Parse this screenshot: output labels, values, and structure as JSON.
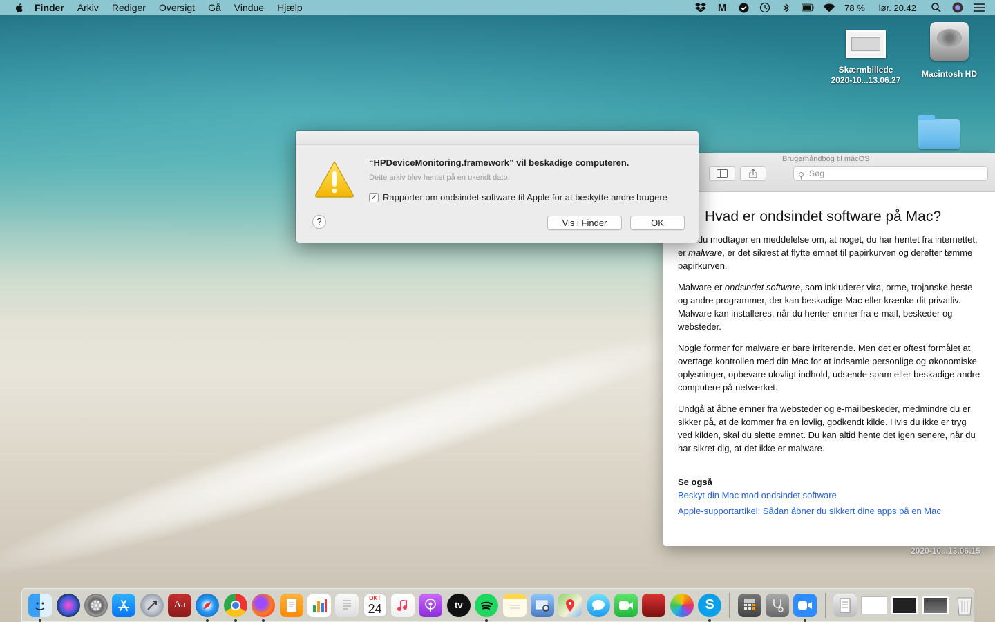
{
  "menubar": {
    "items": [
      "Finder",
      "Arkiv",
      "Rediger",
      "Oversigt",
      "Gå",
      "Vindue",
      "Hjælp"
    ],
    "battery": "78 %",
    "clock": "lør. 20.42",
    "status_icons": [
      "dropbox-icon",
      "m-icon",
      "check-icon",
      "time-machine-icon",
      "bluetooth-icon",
      "battery-icon",
      "wifi-icon",
      "search-icon",
      "siri-icon",
      "list-icon"
    ]
  },
  "desktop": {
    "screenshot_icon_label_1": "Skærmbillede",
    "screenshot_icon_label_2": "2020-10...13.06.27",
    "hd_label": "Macintosh HD",
    "corner_label": "2020-10...13.06.15"
  },
  "alert": {
    "title": "“HPDeviceMonitoring.framework” vil beskadige computeren.",
    "subtitle": "Dette arkiv blev hentet på en ukendt dato.",
    "checkbox_label": "Rapporter om ondsindet software til Apple for at beskytte andre brugere",
    "checkbox_checked": true,
    "help": "?",
    "show_in_finder": "Vis i Finder",
    "ok": "OK"
  },
  "help_window": {
    "title": "Brugerhåndbog til macOS",
    "search_placeholder": "Søg",
    "heading": "Hvad er ondsindet software på Mac?",
    "p1_a": "Hvis du modtager en meddelelse om, at noget, du har hentet fra internettet, er ",
    "p1_em": "malware",
    "p1_b": ", er det sikrest at flytte emnet til papirkurven og derefter tømme papirkurven.",
    "p2_a": "Malware er ",
    "p2_em": "ondsindet software",
    "p2_b": ", som inkluderer vira, orme, trojanske heste og andre programmer, der kan beskadige Mac eller krænke dit privatliv. Malware kan installeres, når du henter emner fra e-mail, beskeder og websteder.",
    "p3": "Nogle former for malware er bare irriterende. Men det er oftest formålet at overtage kontrollen med din Mac for at indsamle personlige og økonomiske oplysninger, opbevare ulovligt indhold, udsende spam eller beskadige andre computere på netværket.",
    "p4": "Undgå at åbne emner fra websteder og e-mailbeskeder, medmindre du er sikker på, at de kommer fra en lovlig, godkendt kilde. Hvis du ikke er tryg ved kilden, skal du slette emnet. Du kan altid hente det igen senere, når du har sikret dig, at det ikke er malware.",
    "see_also": "Se også",
    "link1": "Beskyt din Mac mod ondsindet software",
    "link2": "Apple-supportartikel: Sådan åbner du sikkert dine apps på en Mac"
  },
  "dock": {
    "calendar_month": "OKT",
    "calendar_day": "24",
    "dictionary_glyph": "Aa",
    "tv_label": "tv"
  }
}
